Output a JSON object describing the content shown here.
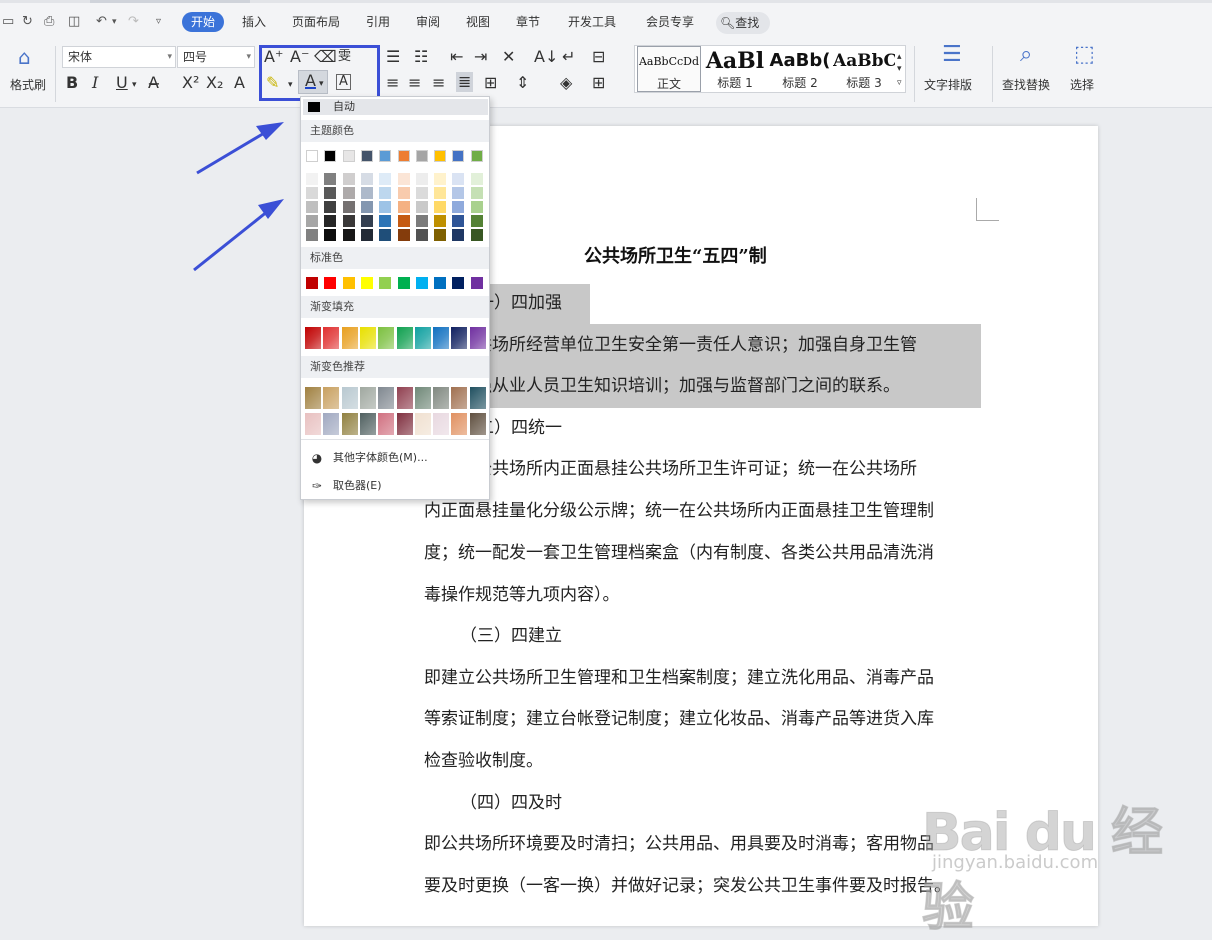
{
  "menu": {
    "tabs": [
      {
        "label": "开始",
        "active": true
      },
      {
        "label": "插入"
      },
      {
        "label": "页面布局"
      },
      {
        "label": "引用"
      },
      {
        "label": "审阅"
      },
      {
        "label": "视图"
      },
      {
        "label": "章节"
      },
      {
        "label": "开发工具"
      },
      {
        "label": "会员专享"
      }
    ],
    "search_label": "查找"
  },
  "ribbon": {
    "format_painter": "格式刷",
    "font_name": "宋体",
    "font_size": "四号",
    "bold": "B",
    "italic": "I",
    "underline": "U",
    "styles": [
      {
        "preview": "AaBbCcDd",
        "label": "正文"
      },
      {
        "preview": "AaBl",
        "label": "标题 1"
      },
      {
        "preview": "AaBb(",
        "label": "标题 2"
      },
      {
        "preview": "AaBbC",
        "label": "标题 3"
      }
    ],
    "text_layout": "文字排版",
    "find_replace": "查找替换",
    "select": "选择"
  },
  "picker": {
    "auto_label": "自动",
    "theme_colors_title": "主题颜色",
    "standard_colors_title": "标准色",
    "gradient_fill_title": "渐变填充",
    "gradient_recommend_title": "渐变色推荐",
    "more_colors": "其他字体颜色(M)...",
    "eyedropper": "取色器(E)",
    "theme_colors": [
      "#ffffff",
      "#000000",
      "#e7e6e6",
      "#44546a",
      "#5b9bd5",
      "#ed7d31",
      "#a5a5a5",
      "#ffc000",
      "#4472c4",
      "#70ad47"
    ],
    "shade_columns": [
      [
        "#f2f2f2",
        "#d9d9d9",
        "#bfbfbf",
        "#a6a6a6",
        "#808080"
      ],
      [
        "#808080",
        "#595959",
        "#404040",
        "#262626",
        "#0d0d0d"
      ],
      [
        "#d0cece",
        "#aeaaaa",
        "#757171",
        "#3a3838",
        "#171616"
      ],
      [
        "#d6dce5",
        "#adb9ca",
        "#8497b0",
        "#333f50",
        "#222a35"
      ],
      [
        "#deebf7",
        "#bdd7ee",
        "#9dc3e6",
        "#2e75b6",
        "#1f4e79"
      ],
      [
        "#fbe5d6",
        "#f8cbad",
        "#f4b183",
        "#c55a11",
        "#843c0c"
      ],
      [
        "#ededed",
        "#dbdbdb",
        "#c9c9c9",
        "#7b7b7b",
        "#525252"
      ],
      [
        "#fff2cc",
        "#ffe699",
        "#ffd966",
        "#bf9000",
        "#7f6000"
      ],
      [
        "#dae3f3",
        "#b4c7e7",
        "#8faadc",
        "#2f5597",
        "#1f3864"
      ],
      [
        "#e2f0d9",
        "#c5e0b4",
        "#a9d18e",
        "#548235",
        "#385723"
      ]
    ],
    "standard_colors": [
      "#c00000",
      "#ff0000",
      "#ffc000",
      "#ffff00",
      "#92d050",
      "#00b050",
      "#00b0f0",
      "#0070c0",
      "#002060",
      "#7030a0"
    ],
    "gradient_fill": [
      "#c00000",
      "#e03030",
      "#e8a020",
      "#e8e000",
      "#7cc040",
      "#10a050",
      "#10a0a0",
      "#1070c0",
      "#102060",
      "#7030a0"
    ],
    "gradient_recommend_row1": [
      "#a08040",
      "#c8a060",
      "#b8c8d0",
      "#a0a8a0",
      "#808890",
      "#904050",
      "#708878",
      "#808880",
      "#a07050",
      "#205060"
    ],
    "gradient_recommend_row2": [
      "#e8c0c0",
      "#a0a8c0",
      "#908040",
      "#506060",
      "#d07080",
      "#803040",
      "#f0e0d0",
      "#e8d8e0",
      "#e09060",
      "#605040"
    ]
  },
  "document": {
    "title": "公共场所卫生“五四”制",
    "lines": [
      "（一）四加强",
      "加强公共场所经营单位卫生安全第一责任人意识；加强自身卫生管",
      "理；加强从业人员卫生知识培训；加强与监督部门之间的联系。",
      "（二）四统一",
      "统一在公共场所内正面悬挂公共场所卫生许可证；统一在公共场所",
      "内正面悬挂量化分级公示牌；统一在公共场所内正面悬挂卫生管理制",
      "度；统一配发一套卫生管理档案盒（内有制度、各类公共用品清洗消",
      "毒操作规范等九项内容）。",
      "（三）四建立",
      "即建立公共场所卫生管理和卫生档案制度；建立洗化用品、消毒产品",
      "等索证制度；建立台帐登记制度；建立化妆品、消毒产品等进货入库",
      "检查验收制度。",
      "（四）四及时",
      "即公共场所环境要及时清扫；公共用品、用具要及时消毒；客用物品",
      "要及时更换（一客一换）并做好记录；突发公共卫生事件要及时报告。"
    ]
  },
  "watermark": {
    "brand": "Bai du 经验",
    "url": "jingyan.baidu.com"
  }
}
